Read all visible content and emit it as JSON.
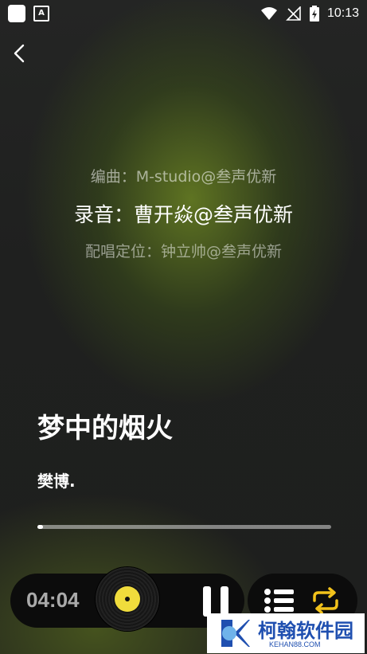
{
  "status_bar": {
    "time": "10:13"
  },
  "credits": {
    "composer": "编曲：M-studio@叁声优新",
    "recording": "录音：曹开焱@叁声优新",
    "vocal_tuning": "配唱定位：钟立帅@叁声优新"
  },
  "song": {
    "title": "梦中的烟火",
    "artist": "樊博."
  },
  "player": {
    "current_time": "04:04",
    "progress": 0.02
  },
  "watermark": {
    "text": "柯翰软件园",
    "sub": "KEHAN88.COM"
  },
  "colors": {
    "accent": "#f0dc3c",
    "loop_icon": "#f2c21b",
    "watermark_blue": "#1f4fb0"
  },
  "icons": [
    "back-arrow-icon",
    "pause-icon",
    "playlist-icon",
    "loop-icon",
    "vinyl-disc-icon",
    "wifi-icon",
    "battery-icon"
  ]
}
